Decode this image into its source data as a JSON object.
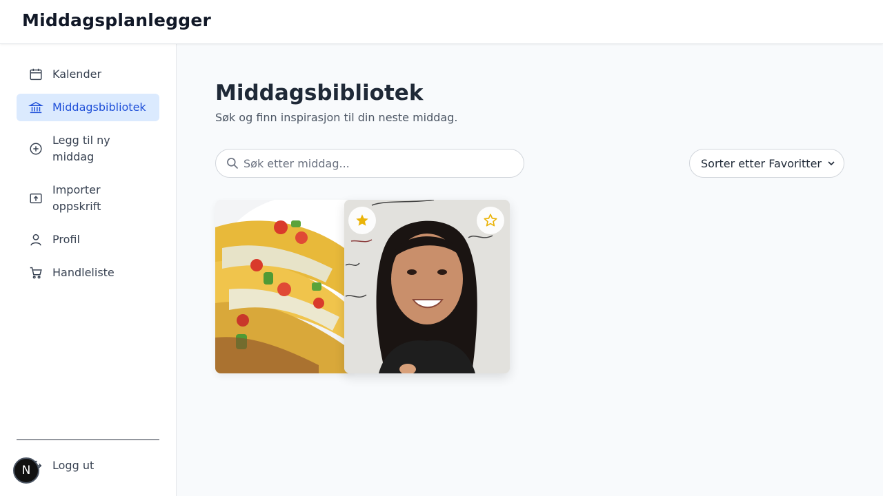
{
  "app": {
    "title": "Middagsplanlegger"
  },
  "sidebar": {
    "items": [
      {
        "label": "Kalender",
        "icon": "calendar-icon"
      },
      {
        "label": "Middagsbibliotek",
        "icon": "library-icon",
        "active": true
      },
      {
        "label": "Legg til ny middag",
        "icon": "plus-circle-icon"
      },
      {
        "label": "Importer oppskrift",
        "icon": "upload-icon"
      },
      {
        "label": "Profil",
        "icon": "user-icon"
      },
      {
        "label": "Handleliste",
        "icon": "cart-icon"
      }
    ],
    "logout_label": "Logg ut",
    "logout_icon": "logout-icon"
  },
  "main": {
    "title": "Middagsbibliotek",
    "subtitle": "Søk og finn inspirasjon til din neste middag.",
    "search": {
      "placeholder": "Søk etter middag..."
    },
    "sort_label": "Sorter etter Favoritter",
    "cards": [
      {
        "image": "tacos-photo",
        "favorite": true
      },
      {
        "image": "person-photo",
        "favorite": false
      }
    ]
  },
  "badge": {
    "letter": "N"
  },
  "colors": {
    "accent": "#1d4ed8",
    "active_bg": "#dbeafe",
    "star": "#eab308"
  }
}
